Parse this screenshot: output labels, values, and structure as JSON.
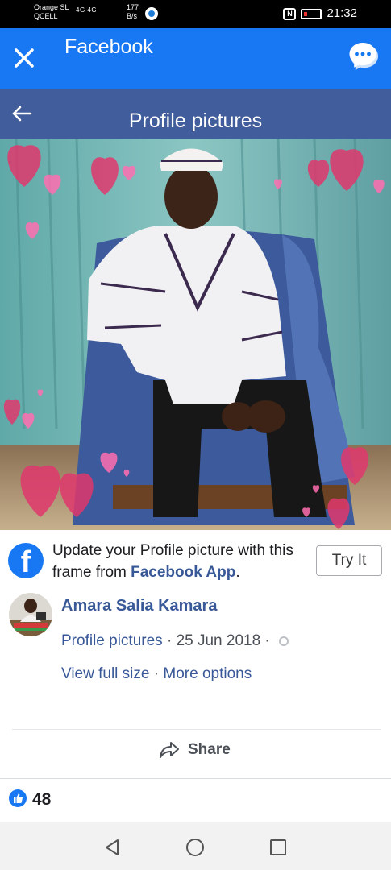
{
  "status_bar": {
    "carrier_line1": "Orange SL",
    "carrier_line2": "QCELL",
    "network": "4G 4G",
    "speed_value": "177",
    "speed_unit": "B/s",
    "time": "21:32"
  },
  "app_bar": {
    "title": "Facebook",
    "close_icon": "close-icon",
    "messenger_icon": "messenger-icon"
  },
  "sub_header": {
    "title": "Profile pictures",
    "back_icon": "back-arrow-icon"
  },
  "photo": {
    "description_icon": "profile-photo"
  },
  "promo": {
    "text_main": "Update your Profile picture with this frame from ",
    "text_link": "Facebook App",
    "text_end": ".",
    "button": "Try It"
  },
  "post": {
    "author": "Amara Salia Kamara",
    "album": "Profile pictures",
    "date": "25 Jun 2018",
    "separator": " · ",
    "view_full": "View full size",
    "more_options": "More options"
  },
  "actions": {
    "share": "Share"
  },
  "reactions": {
    "like_count": "48"
  },
  "colors": {
    "facebook_blue": "#1877f2",
    "header_blue": "#425d9b",
    "link_blue": "#385898"
  }
}
